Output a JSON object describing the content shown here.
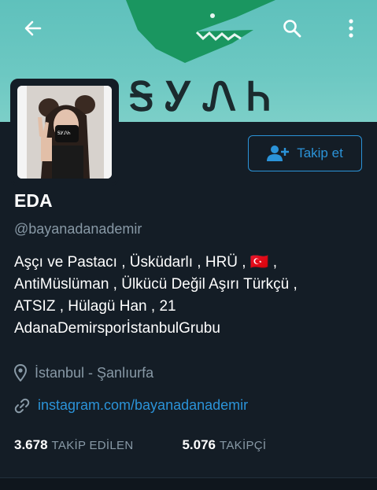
{
  "banner": {
    "runic_text": "ᎦᎩᏁᏂ",
    "background_color": "#6cc8c2",
    "wolf_color": "#1a9660"
  },
  "header": {
    "back_icon": "arrow-left-icon",
    "search_icon": "search-icon",
    "more_icon": "more-vertical-icon"
  },
  "profile": {
    "name": "EDA",
    "handle": "@bayanadanademir",
    "follow_label": "Takip et",
    "bio_lines": [
      "Aşçı ve Pastacı , Üsküdarlı , HRÜ , 🇹🇷 ,",
      "AntiMüslüman , Ülkücü Değil Aşırı Türkçü ,",
      "ATSIZ , Hülagü Han , 21",
      "AdanaDemirsporİstanbulGrubu"
    ],
    "location": "İstanbul - Şanlıurfa",
    "website": "instagram.com/bayanadanademir"
  },
  "stats": {
    "following_count": "3.678",
    "following_label": "TAKİP EDİLEN",
    "followers_count": "5.076",
    "followers_label": "TAKİPÇİ"
  },
  "colors": {
    "background": "#141d26",
    "accent": "#2b93d8",
    "muted": "#8899a6"
  }
}
